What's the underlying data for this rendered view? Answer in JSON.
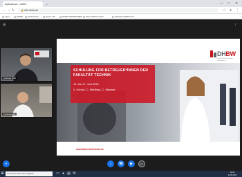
{
  "browser": {
    "tabs": [
      {
        "label": "BigBlueButton - DHBW..."
      },
      {
        "label": "+"
      }
    ],
    "address": "bbb.dhbw.de",
    "bookmarks": [
      {
        "label": "Apps"
      },
      {
        "label": "DHBW"
      },
      {
        "label": "Nachrichten"
      },
      {
        "label": "Neuer Tab"
      },
      {
        "label": "DHBW HEIDENHEIM"
      },
      {
        "label": "https://dhbw-heiden..."
      },
      {
        "label": "Aktuelle DHBW-CAS"
      }
    ],
    "window_controls": {
      "minimize": "—",
      "maximize": "□",
      "close": "✕"
    }
  },
  "meeting": {
    "participants": [
      {
        "name": "Andreas Wolf",
        "kind": "webcam"
      },
      {
        "name": "Kursbetreuer",
        "kind": "webcam"
      }
    ],
    "slide": {
      "logo_dh": "DH",
      "logo_bw": "BW",
      "logo_sub": "Duale Hochschule Baden-Württemberg",
      "title": "SCHULUNG FÜR BETREUER*INNEN DER FAKULTÄT TECHNIK",
      "date": "14. bis 17. Juni 2021",
      "names": "V. Schulz, C. Mühlbas, C. Stanske",
      "url": "www.dhbw-heidenheim.de"
    },
    "controls": [
      {
        "icon": "add-icon",
        "glyph": "+"
      },
      {
        "icon": "microphone-icon",
        "glyph": "♪"
      },
      {
        "icon": "phone-icon",
        "glyph": "☎"
      },
      {
        "icon": "camera-icon",
        "glyph": "▶"
      },
      {
        "icon": "screen-share-icon",
        "glyph": "▭"
      }
    ]
  },
  "taskbar": {
    "search_placeholder": "Zur Suche Text hier eingeben",
    "time": "10:22",
    "date": "10.06.2021"
  },
  "colors": {
    "accent_red": "#c4161c",
    "button_blue": "#1a73e8"
  }
}
